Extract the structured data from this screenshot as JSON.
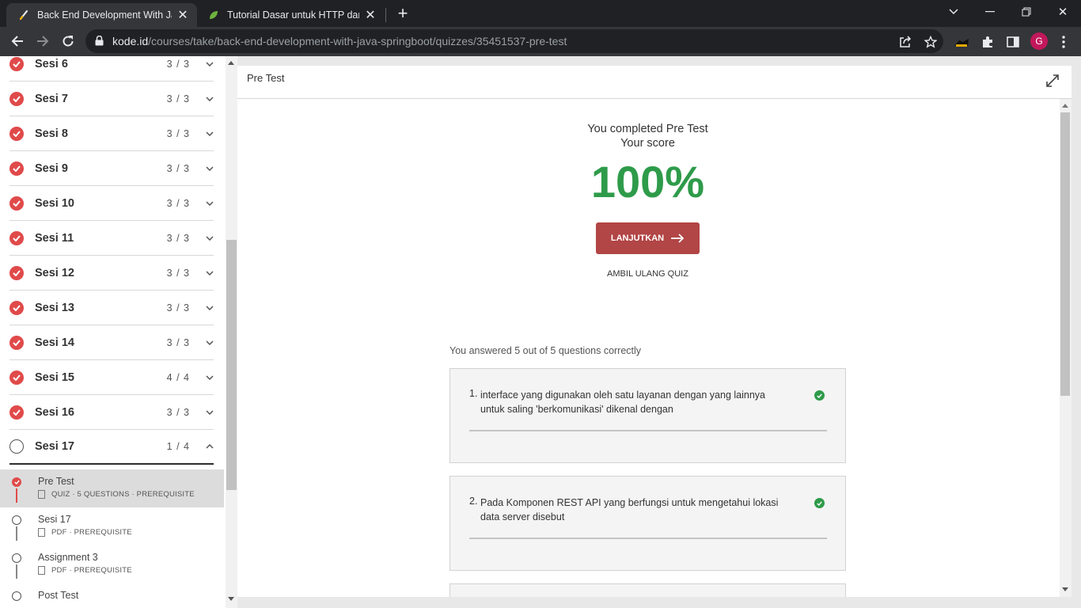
{
  "browser": {
    "tabs": [
      {
        "title": "Back End Development With Java",
        "active": true
      },
      {
        "title": "Tutorial Dasar untuk HTTP dan REST",
        "active": false
      }
    ],
    "url_host": "kode.id",
    "url_path": "/courses/take/back-end-development-with-java-springboot/quizzes/35451537-pre-test",
    "profile_initial": "G"
  },
  "sidebar": {
    "sessions": [
      {
        "label": "Sesi 6",
        "count": "3 / 3",
        "done": true
      },
      {
        "label": "Sesi 7",
        "count": "3 / 3",
        "done": true
      },
      {
        "label": "Sesi 8",
        "count": "3 / 3",
        "done": true
      },
      {
        "label": "Sesi 9",
        "count": "3 / 3",
        "done": true
      },
      {
        "label": "Sesi 10",
        "count": "3 / 3",
        "done": true
      },
      {
        "label": "Sesi 11",
        "count": "3 / 3",
        "done": true
      },
      {
        "label": "Sesi 12",
        "count": "3 / 3",
        "done": true
      },
      {
        "label": "Sesi 13",
        "count": "3 / 3",
        "done": true
      },
      {
        "label": "Sesi 14",
        "count": "3 / 3",
        "done": true
      },
      {
        "label": "Sesi 15",
        "count": "4 / 4",
        "done": true
      },
      {
        "label": "Sesi 16",
        "count": "3 / 3",
        "done": true
      },
      {
        "label": "Sesi 17",
        "count": "1 / 4",
        "done": false
      }
    ],
    "lessons": [
      {
        "title": "Pre Test",
        "meta": "QUIZ · 5 QUESTIONS · PREREQUISITE",
        "done": true,
        "active": true
      },
      {
        "title": "Sesi 17",
        "meta": "PDF · PREREQUISITE",
        "done": false,
        "active": false
      },
      {
        "title": "Assignment 3",
        "meta": "PDF · PREREQUISITE",
        "done": false,
        "active": false
      },
      {
        "title": "Post Test",
        "meta": "",
        "done": false,
        "active": false
      }
    ]
  },
  "main": {
    "title": "Pre Test",
    "completed_line1": "You completed Pre Test",
    "completed_line2": "Your score",
    "score": "100%",
    "continue_label": "LANJUTKAN",
    "retake_label": "AMBIL ULANG QUIZ",
    "answered_text": "You answered 5 out of 5 questions correctly",
    "questions": [
      {
        "number": "1.",
        "text": "interface yang digunakan oleh satu layanan dengan yang lainnya untuk saling 'berkomunikasi' dikenal dengan",
        "correct": true
      },
      {
        "number": "2.",
        "text": "Pada Komponen REST API yang berfungsi untuk mengetahui lokasi data server disebut",
        "correct": true
      }
    ]
  },
  "colors": {
    "accent_red": "#b24545",
    "check_red": "#e04a4a",
    "score_green": "#2e9b4a"
  }
}
